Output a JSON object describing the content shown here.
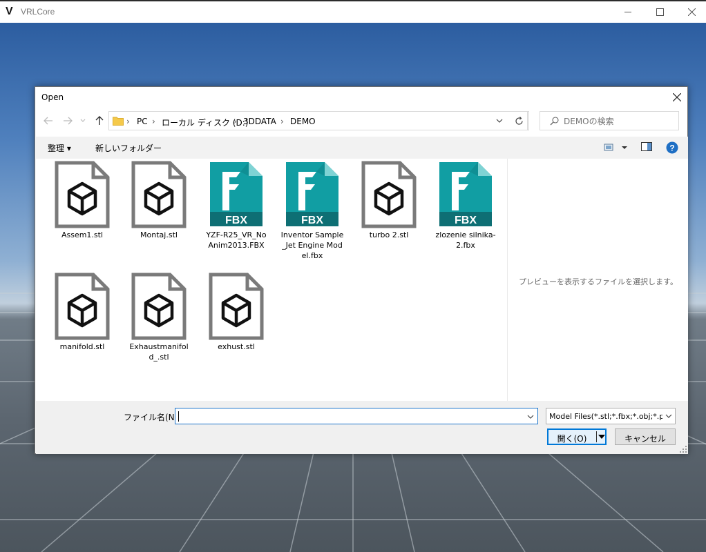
{
  "app": {
    "title": "VRLCore",
    "logo": "V"
  },
  "dialog": {
    "title": "Open",
    "breadcrumb": [
      "PC",
      "ローカル ディスク (D:)",
      "3DDATA",
      "DEMO"
    ],
    "search_placeholder": "DEMOの検索",
    "toolbar": {
      "organize": "整理 ▾",
      "new_folder": "新しいフォルダー"
    },
    "files": [
      {
        "name": "Assem1.stl",
        "type": "stl"
      },
      {
        "name": "Montaj.stl",
        "type": "stl"
      },
      {
        "name": "YZF-R25_VR_NoAnim2013.FBX",
        "type": "fbx"
      },
      {
        "name": "Inventor Sample_Jet Engine Model.fbx",
        "type": "fbx"
      },
      {
        "name": "turbo 2.stl",
        "type": "stl"
      },
      {
        "name": "zlozenie silnika-2.fbx",
        "type": "fbx"
      },
      {
        "name": "manifold.stl",
        "type": "stl"
      },
      {
        "name": "Exhaustmanifold_.stl",
        "type": "stl"
      },
      {
        "name": "exhust.stl",
        "type": "stl"
      }
    ],
    "fbx_badge": "FBX",
    "preview_text": "プレビューを表示するファイルを選択します。",
    "filename_label": "ファイル名(N):",
    "filename_value": "",
    "file_type": "Model Files(*.stl;*.fbx;*.obj;*.ply)",
    "open_label": "開く(O)",
    "cancel_label": "キャンセル"
  }
}
